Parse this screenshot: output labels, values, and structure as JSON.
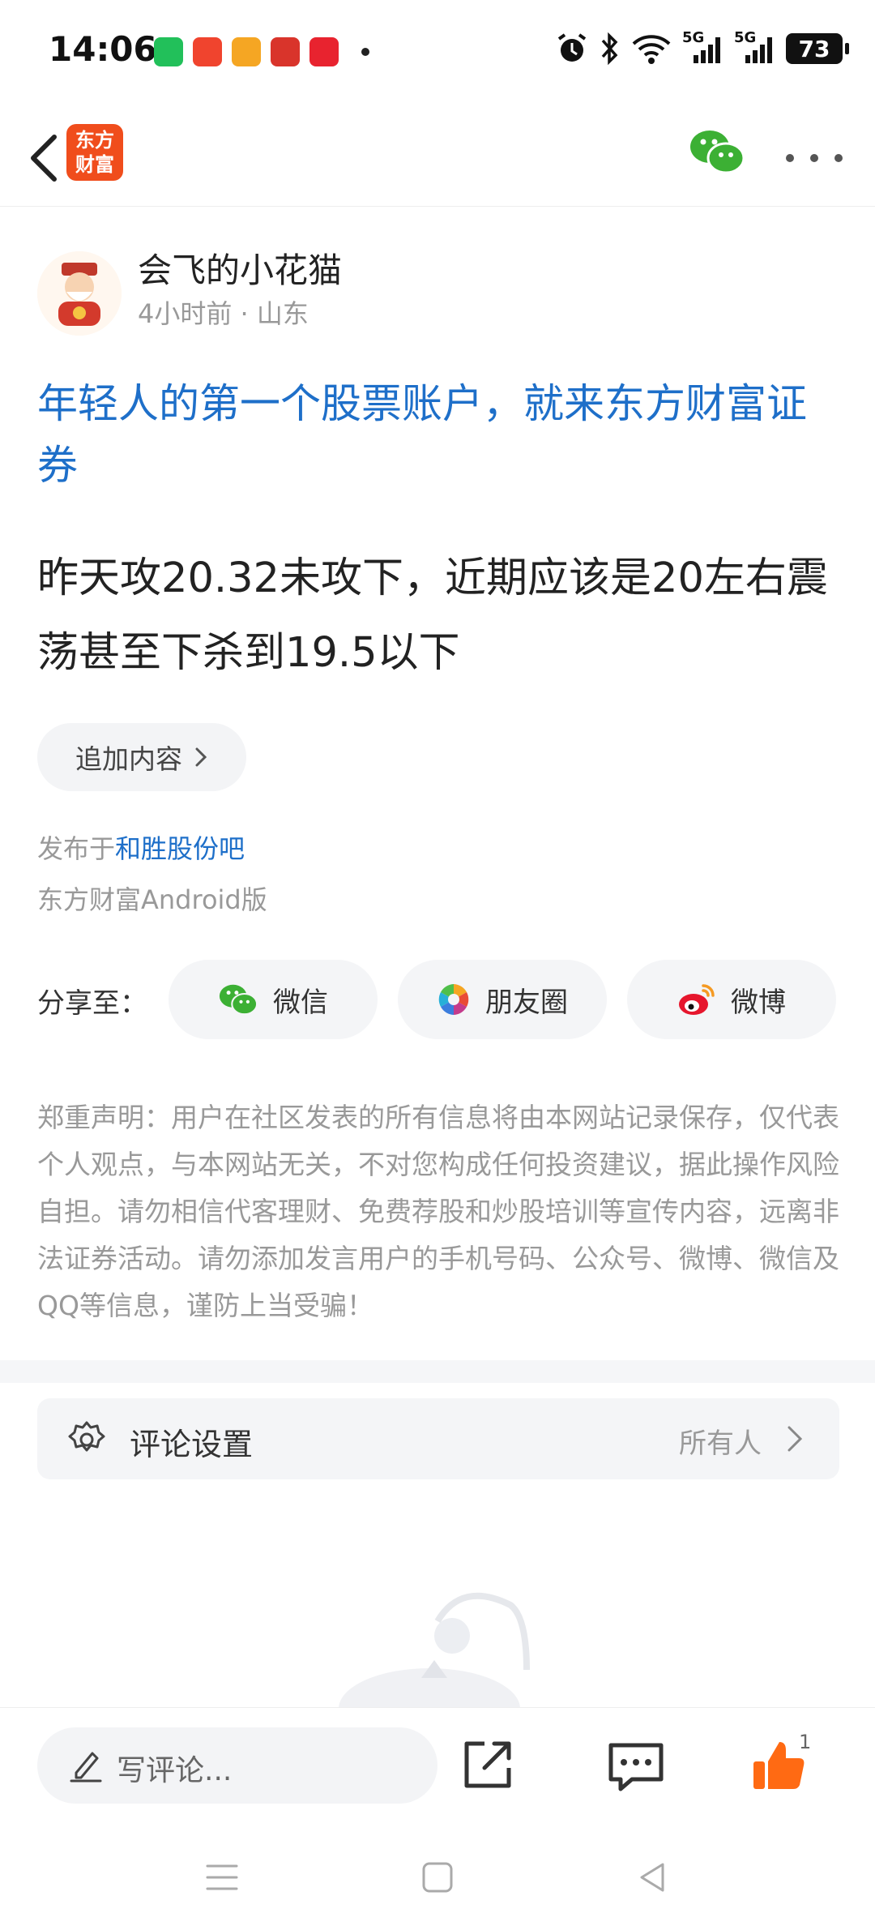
{
  "status_bar": {
    "time": "14:06",
    "notifications": [
      {
        "icon": "wechat-icon",
        "color": "#22c05a"
      },
      {
        "icon": "toutiao-icon",
        "color": "#f0442e"
      },
      {
        "icon": "video-app-icon",
        "color": "#f5a623"
      },
      {
        "icon": "news-app-icon",
        "color": "#d9342b"
      },
      {
        "icon": "xiaohongshu-icon",
        "color": "#e8232f"
      }
    ],
    "signal_1": "5G",
    "signal_2": "5G",
    "battery": "73"
  },
  "app_bar": {
    "logo_line1": "东方",
    "logo_line2": "财富",
    "brand_color": "#f04d1c"
  },
  "author": {
    "name": "会飞的小花猫",
    "meta": "4小时前 · 山东"
  },
  "post": {
    "promo_link": "年轻人的第一个股票账户，就来东方财富证券",
    "body": "昨天攻20.32未攻下，近期应该是20左右震荡甚至下杀到19.5以下",
    "append_label": "追加内容",
    "published_prefix": "发布于",
    "published_bar": "和胜股份吧",
    "platform": "东方财富Android版"
  },
  "share": {
    "label": "分享至：",
    "wechat": "微信",
    "moments": "朋友圈",
    "weibo": "微博"
  },
  "disclaimer": "郑重声明：用户在社区发表的所有信息将由本网站记录保存，仅代表个人观点，与本网站无关，不对您构成任何投资建议，据此操作风险自担。请勿相信代客理财、免费荐股和炒股培训等宣传内容，远离非法证券活动。请勿添加发言用户的手机号码、公众号、微博、微信及QQ等信息，谨防上当受骗！",
  "comment_settings": {
    "label": "评论设置",
    "value": "所有人"
  },
  "bottom_bar": {
    "comment_placeholder": "写评论...",
    "like_count": "1",
    "accent": "#ff6a13"
  }
}
